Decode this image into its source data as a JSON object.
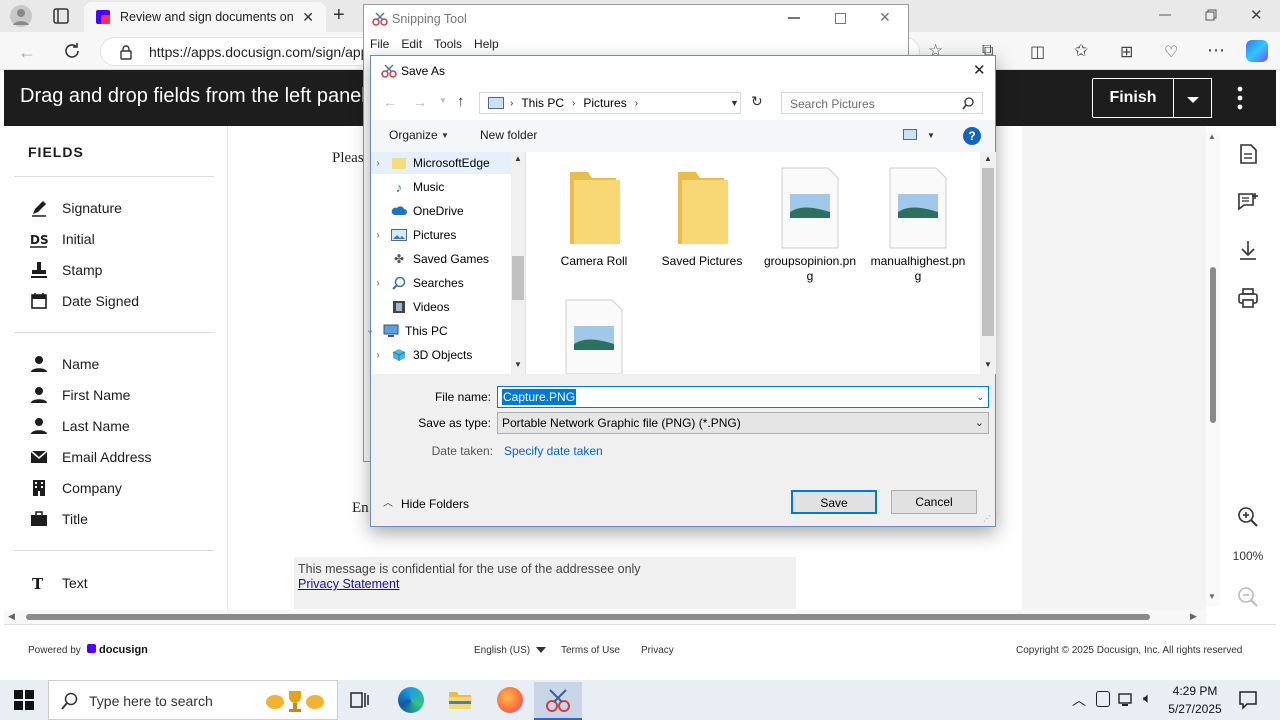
{
  "browser": {
    "tab_title": "Review and sign documents on Docusign",
    "url": "https://apps.docusign.com/sign/app..."
  },
  "docusign": {
    "header_message": "Drag and drop fields from the left panel",
    "finish_label": "Finish",
    "fields_heading": "FIELDS",
    "fields": [
      {
        "label": "Signature",
        "icon": "pen-icon"
      },
      {
        "label": "Initial",
        "icon": "initial-icon"
      },
      {
        "label": "Stamp",
        "icon": "stamp-icon"
      },
      {
        "label": "Date Signed",
        "icon": "calendar-icon"
      },
      {
        "label": "Name",
        "icon": "person-icon"
      },
      {
        "label": "First Name",
        "icon": "person-icon"
      },
      {
        "label": "Last Name",
        "icon": "person-icon"
      },
      {
        "label": "Email Address",
        "icon": "mail-icon"
      },
      {
        "label": "Company",
        "icon": "building-icon"
      },
      {
        "label": "Title",
        "icon": "briefcase-icon"
      },
      {
        "label": "Text",
        "icon": "text-icon"
      }
    ],
    "doc_fragment_please": "Pleas",
    "doc_fragment_en": "En",
    "confidential_note": "This message is confidential for the use of the addressee only",
    "privacy_link": "Privacy Statement",
    "zoom_level": "100%",
    "footer": {
      "powered_by": "Powered by",
      "brand": "docusign",
      "language": "English (US)",
      "terms": "Terms of Use",
      "privacy": "Privacy",
      "copyright": "Copyright © 2025 Docusign, Inc. All rights reserved"
    }
  },
  "snipping_tool": {
    "title": "Snipping Tool",
    "menu": [
      "File",
      "Edit",
      "Tools",
      "Help"
    ]
  },
  "save_as": {
    "title": "Save As",
    "breadcrumb": [
      "This PC",
      "Pictures"
    ],
    "search_placeholder": "Search Pictures",
    "organize": "Organize",
    "new_folder": "New folder",
    "tree": [
      {
        "label": "MicrosoftEdge",
        "expandable": true
      },
      {
        "label": "Music",
        "expandable": false
      },
      {
        "label": "OneDrive",
        "expandable": false
      },
      {
        "label": "Pictures",
        "expandable": true
      },
      {
        "label": "Saved Games",
        "expandable": false
      },
      {
        "label": "Searches",
        "expandable": true
      },
      {
        "label": "Videos",
        "expandable": false
      },
      {
        "label": "This PC",
        "expandable": true
      },
      {
        "label": "3D Objects",
        "expandable": true
      }
    ],
    "files": [
      {
        "name": "Camera Roll",
        "kind": "folder"
      },
      {
        "name": "Saved Pictures",
        "kind": "folder"
      },
      {
        "name": "groupsopinion.png",
        "kind": "image"
      },
      {
        "name": "manualhighest.png",
        "kind": "image"
      },
      {
        "name": "",
        "kind": "image"
      }
    ],
    "file_name_label": "File name:",
    "file_name_value": "Capture.PNG",
    "save_type_label": "Save as type:",
    "save_type_value": "Portable Network Graphic file (PNG) (*.PNG)",
    "date_taken_label": "Date taken:",
    "date_taken_link": "Specify date taken",
    "hide_folders": "Hide Folders",
    "save_button": "Save",
    "cancel_button": "Cancel"
  },
  "taskbar": {
    "search_placeholder": "Type here to search",
    "time": "4:29 PM",
    "date": "5/27/2025"
  },
  "colors": {
    "docusign_header": "#1d1d1d",
    "accent_blue": "#0067c0",
    "link_blue": "#1a0dab",
    "selection_blue": "#0078d7"
  }
}
